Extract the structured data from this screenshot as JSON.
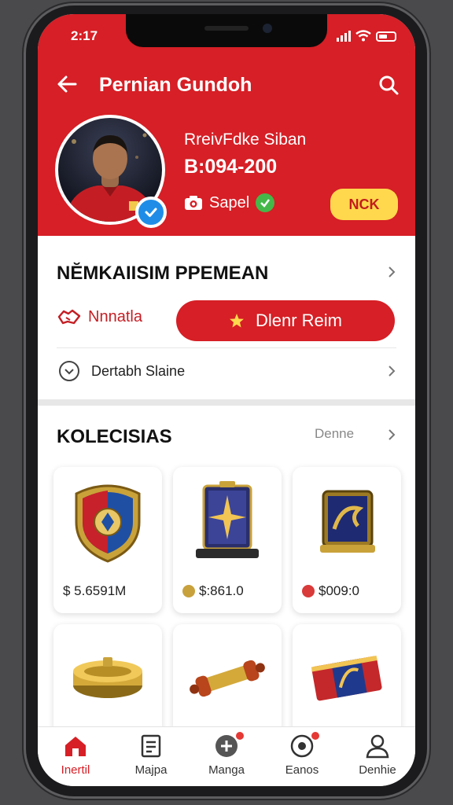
{
  "status_bar": {
    "time": "2:17"
  },
  "header": {
    "title": "Pernian Gundoh"
  },
  "profile": {
    "name": "RreivFdke Siban",
    "id": "B:094-200",
    "sapel_label": "Sapel",
    "badge_button": "NCK"
  },
  "section_profile": {
    "title": "NĔMKAIISIM PPEMEAN",
    "secondary_label": "Nnnatla",
    "primary_button": "Dlenr Reim",
    "detail_row": "Dertabh Slaine"
  },
  "collections": {
    "title": "KOLECISIAS",
    "more_label": "Denne",
    "items": [
      {
        "price": "$ 5.6591M"
      },
      {
        "price": "$:861.0"
      },
      {
        "price": "$009:0"
      },
      {
        "price": ""
      },
      {
        "price": ""
      },
      {
        "price": ""
      }
    ]
  },
  "tabbar": {
    "tabs": [
      {
        "label": "Inertil"
      },
      {
        "label": "Majpa"
      },
      {
        "label": "Manga"
      },
      {
        "label": "Eanos"
      },
      {
        "label": "Denhie"
      }
    ]
  },
  "colors": {
    "brand_red": "#d61f26",
    "accent_yellow": "#ffd84d",
    "verified_blue": "#1f8de8"
  }
}
